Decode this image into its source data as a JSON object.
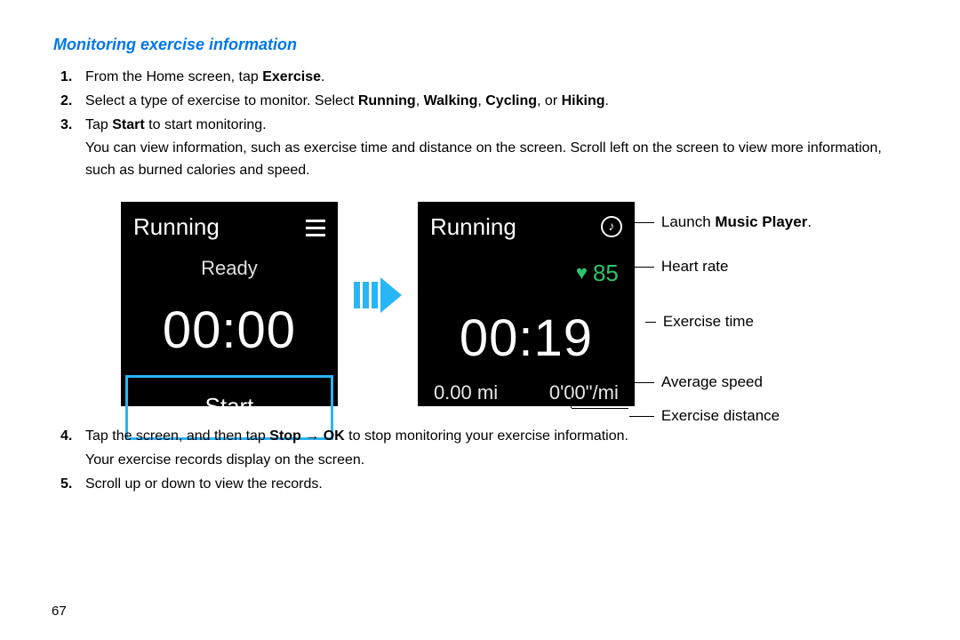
{
  "section_title": "Monitoring exercise information",
  "steps": {
    "s1_pre": "From the Home screen, tap ",
    "s1_bold": "Exercise",
    "s1_post": ".",
    "s2_pre": "Select a type of exercise to monitor. Select ",
    "s2_b1": "Running",
    "s2_c1": ", ",
    "s2_b2": "Walking",
    "s2_c2": ", ",
    "s2_b3": "Cycling",
    "s2_c3": ", or ",
    "s2_b4": "Hiking",
    "s2_post": ".",
    "s3_pre": "Tap ",
    "s3_bold": "Start",
    "s3_post": " to start monitoring.",
    "s3_sub": "You can view information, such as exercise time and distance on the screen. Scroll left on the screen to view more information, such as burned calories and speed.",
    "s4_pre": "Tap the screen, and then tap ",
    "s4_b1": "Stop",
    "s4_arrow": " → ",
    "s4_b2": "OK",
    "s4_post": " to stop monitoring your exercise information.",
    "s4_sub": "Your exercise records display on the screen.",
    "s5": "Scroll up or down to view the records."
  },
  "screen1": {
    "title": "Running",
    "status": "Ready",
    "time": "00:00",
    "start": "Start"
  },
  "screen2": {
    "title": "Running",
    "music_glyph": "♪",
    "heart_value": "85",
    "time": "00:19",
    "distance": "0.00 mi",
    "pace": "0'00\"/mi"
  },
  "annotations": {
    "music_pre": "Launch ",
    "music_bold": "Music Player",
    "music_post": ".",
    "heart_rate": "Heart rate",
    "exercise_time": "Exercise time",
    "avg_speed": "Average speed",
    "exercise_distance": "Exercise distance"
  },
  "page_number": "67"
}
